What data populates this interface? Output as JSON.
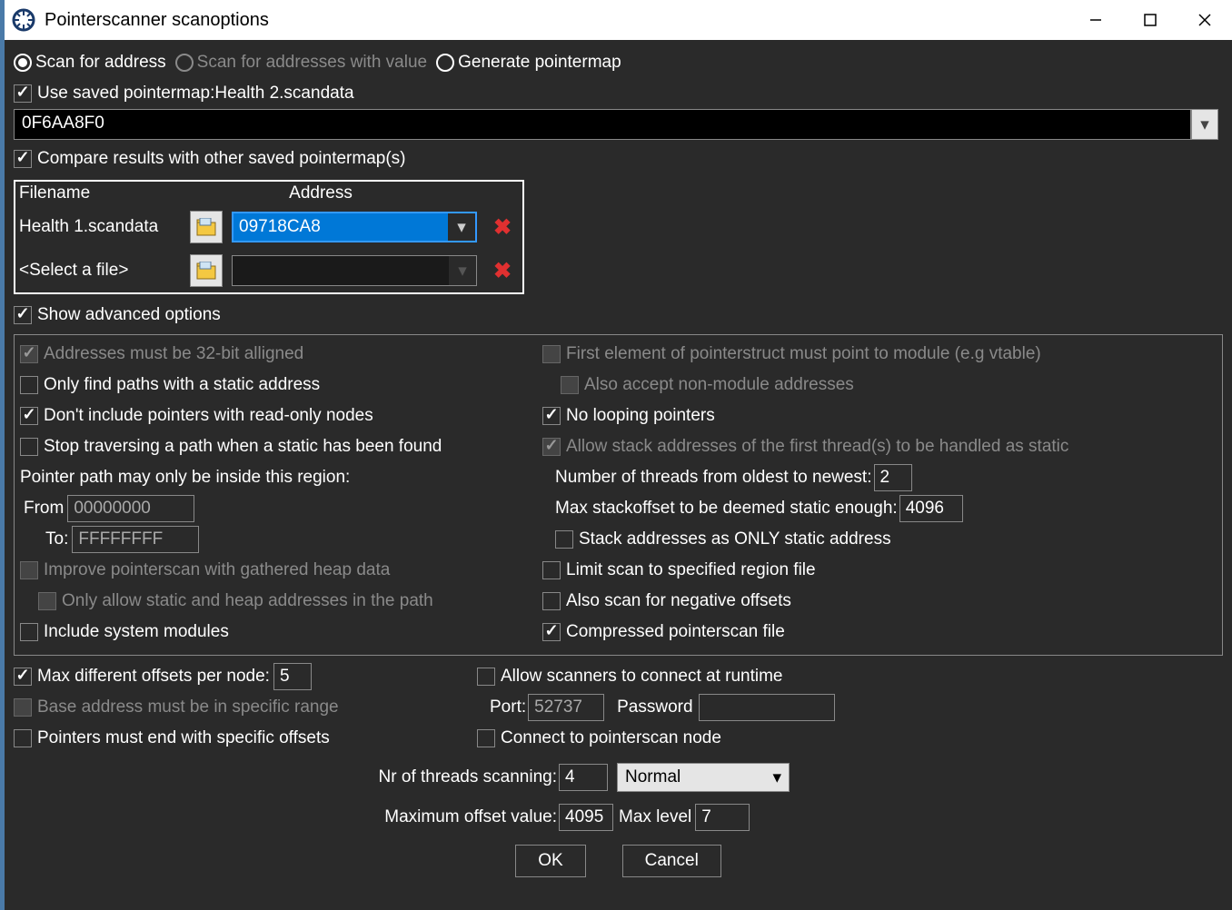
{
  "window_title": "Pointerscanner scanoptions",
  "scan_mode": {
    "scan_for_address": "Scan for address",
    "scan_for_addresses_with_value": "Scan for addresses with value",
    "generate_pointermap": "Generate pointermap"
  },
  "use_saved_pointermap_label": "Use saved pointermap:",
  "use_saved_pointermap_file": "Health 2.scandata",
  "address_input": "0F6AA8F0",
  "compare_results_label": "Compare results with other saved pointermap(s)",
  "compare_table": {
    "header_filename": "Filename",
    "header_address": "Address",
    "rows": [
      {
        "filename": "Health 1.scandata",
        "address": "09718CA8",
        "selected": true
      },
      {
        "filename": "<Select a file>",
        "address": "",
        "selected": false
      }
    ]
  },
  "show_advanced_label": "Show advanced options",
  "advanced": {
    "addresses_32bit": "Addresses must be 32-bit alligned",
    "only_static": "Only find paths with a static address",
    "no_readonly": "Don't include pointers with read-only nodes",
    "stop_traversing": "Stop traversing a path when a static has been found",
    "region_label": "Pointer path may only be inside this region:",
    "from_label": "From",
    "from_value": "00000000",
    "to_label": "To:",
    "to_value": "FFFFFFFF",
    "improve_heap": "Improve pointerscan with gathered heap data",
    "only_static_heap": "Only allow static and heap addresses in the path",
    "include_system": "Include system modules",
    "first_element_vtable": "First element of pointerstruct must point to module (e.g vtable)",
    "also_accept_nonmodule": "Also accept non-module addresses",
    "no_looping": "No looping pointers",
    "allow_stack": "Allow stack addresses of the first thread(s) to be handled as static",
    "num_threads_label": "Number of threads from oldest to newest:",
    "num_threads_value": "2",
    "max_stackoffset_label": "Max stackoffset to be deemed static enough:",
    "max_stackoffset_value": "4096",
    "stack_only_static": "Stack addresses as ONLY static address",
    "limit_region_file": "Limit scan to specified region file",
    "negative_offsets": "Also scan for negative offsets",
    "compressed_file": "Compressed pointerscan file"
  },
  "bottom": {
    "max_diff_offsets_label": "Max different offsets per node:",
    "max_diff_offsets_value": "5",
    "base_addr_range": "Base address must be in specific range",
    "pointers_end_offsets": "Pointers must end with specific offsets",
    "allow_scanners_runtime": "Allow scanners to connect at runtime",
    "port_label": "Port:",
    "port_value": "52737",
    "password_label": "Password",
    "password_value": "",
    "connect_node": "Connect to pointerscan node"
  },
  "footer": {
    "nr_threads_label": "Nr of threads scanning:",
    "nr_threads_value": "4",
    "priority_value": "Normal",
    "max_offset_label": "Maximum offset value:",
    "max_offset_value": "4095",
    "max_level_label": "Max level",
    "max_level_value": "7",
    "ok": "OK",
    "cancel": "Cancel"
  }
}
